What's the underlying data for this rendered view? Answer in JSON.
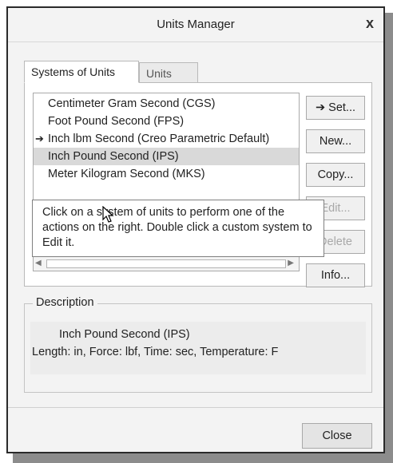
{
  "dialog": {
    "title": "Units Manager",
    "close_glyph": "x"
  },
  "tabs": [
    {
      "label": "Systems of Units",
      "active": true
    },
    {
      "label": "Units",
      "active": false
    }
  ],
  "systems_list": {
    "items": [
      {
        "label": "Centimeter Gram Second (CGS)",
        "marker": ""
      },
      {
        "label": "Foot Pound Second (FPS)",
        "marker": ""
      },
      {
        "label": "Inch lbm Second (Creo Parametric Default)",
        "marker": "➔"
      },
      {
        "label": "Inch Pound Second (IPS)",
        "marker": "",
        "selected": true
      },
      {
        "label": "Meter Kilogram Second (MKS)",
        "marker": ""
      }
    ],
    "scroll": {
      "left": "◀",
      "right": "▶"
    }
  },
  "buttons": {
    "set": "➔ Set...",
    "new": "New...",
    "copy": "Copy...",
    "edit": "Edit...",
    "delete": "Delete",
    "info": "Info..."
  },
  "tooltip": {
    "text": "Click on a system of units to perform one of the actions on the right. Double click a custom system to Edit it."
  },
  "description": {
    "legend": "Description",
    "name": "Inch Pound Second (IPS)",
    "detail": "Length: in, Force: lbf, Time: sec, Temperature: F"
  },
  "footer": {
    "close_label": "Close"
  }
}
